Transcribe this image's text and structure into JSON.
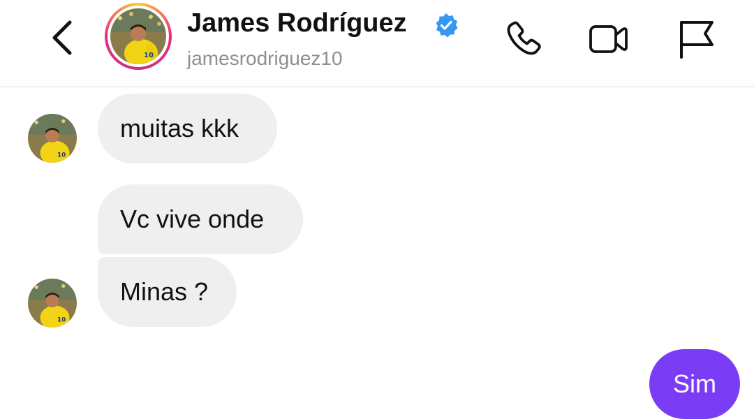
{
  "header": {
    "display_name": "James Rodríguez",
    "username": "jamesrodriguez10",
    "icons": {
      "back": "chevron-left-icon",
      "verified": "verified-badge-icon",
      "call": "phone-icon",
      "video": "video-camera-icon",
      "report": "flag-icon"
    },
    "story_ring_colors": [
      "#f9ce34",
      "#ee2a7b",
      "#c13584"
    ],
    "verified_color": "#3897f0"
  },
  "messages": [
    {
      "direction": "received",
      "text": "muitas kkk"
    },
    {
      "direction": "received",
      "text": "Vc vive onde"
    },
    {
      "direction": "received",
      "text": "Minas ?"
    },
    {
      "direction": "sent",
      "text": "Sim"
    }
  ],
  "colors": {
    "received_bubble": "#efefef",
    "sent_bubble": "#7a3cf5",
    "username_text": "#8e8e8e"
  }
}
